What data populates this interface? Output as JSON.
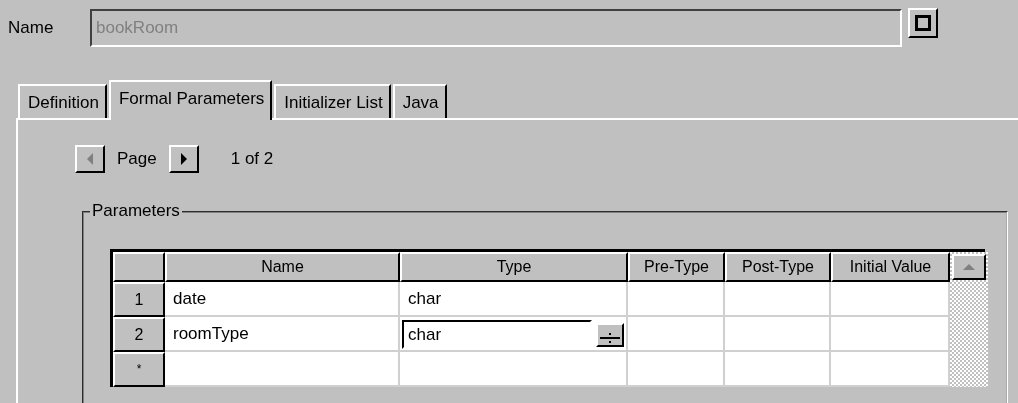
{
  "name_field": {
    "label": "Name",
    "value": "bookRoom",
    "disabled": true
  },
  "tabs": [
    {
      "label": "Definition",
      "selected": false
    },
    {
      "label": "Formal Parameters",
      "selected": true
    },
    {
      "label": "Initializer List",
      "selected": false
    },
    {
      "label": "Java",
      "selected": false
    }
  ],
  "pager": {
    "label": "Page",
    "prev_disabled": true,
    "next_disabled": false,
    "position": "1 of 2"
  },
  "parameters": {
    "title": "Parameters",
    "columns": [
      "Name",
      "Type",
      "Pre-Type",
      "Post-Type",
      "Initial Value"
    ],
    "rows": [
      {
        "header": "1",
        "name": "date",
        "type": "char",
        "editing": false
      },
      {
        "header": "2",
        "name": "roomType",
        "type": "char",
        "editing": true
      },
      {
        "header": "*",
        "name": "",
        "type": "",
        "editing": false
      }
    ]
  }
}
